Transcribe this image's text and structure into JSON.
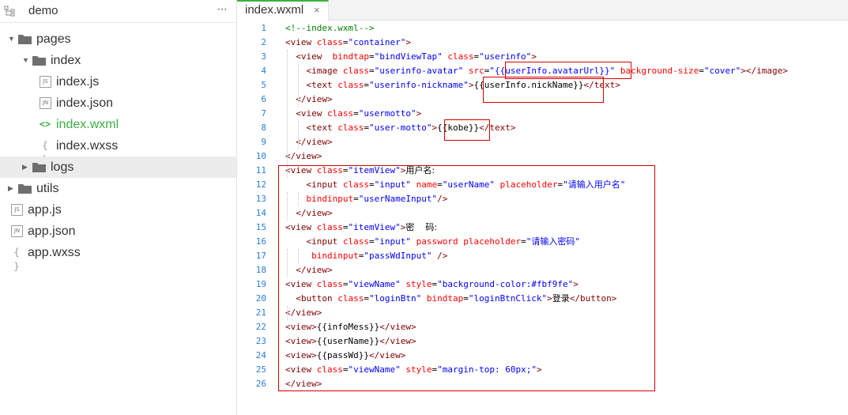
{
  "project": {
    "name": "demo",
    "more_label": "···"
  },
  "tree": [
    {
      "label": "pages",
      "kind": "folder",
      "expanded": true,
      "depth": 0
    },
    {
      "label": "index",
      "kind": "folder",
      "expanded": true,
      "depth": 1
    },
    {
      "label": "index.js",
      "kind": "file",
      "icon_text": "JS",
      "depth": 2
    },
    {
      "label": "index.json",
      "kind": "file",
      "icon_text": "JN",
      "depth": 2
    },
    {
      "label": "index.wxml",
      "kind": "glyph",
      "icon_text": "<>",
      "depth": 2,
      "active": true
    },
    {
      "label": "index.wxss",
      "kind": "glyph",
      "icon_text": "{ }",
      "depth": 2
    },
    {
      "label": "logs",
      "kind": "folder",
      "expanded": false,
      "depth": 1,
      "selected": true
    },
    {
      "label": "utils",
      "kind": "folder",
      "expanded": false,
      "depth": 0
    },
    {
      "label": "app.js",
      "kind": "file",
      "icon_text": "JS",
      "depth": 0
    },
    {
      "label": "app.json",
      "kind": "file",
      "icon_text": "JN",
      "depth": 0
    },
    {
      "label": "app.wxss",
      "kind": "glyph",
      "icon_text": "{ }",
      "depth": 0
    }
  ],
  "editor": {
    "tab": {
      "label": "index.wxml",
      "close": "×"
    },
    "lines": [
      {
        "n": "1",
        "tokens": [
          [
            "cm",
            "<!--index.wxml-->"
          ]
        ]
      },
      {
        "n": "2",
        "tokens": [
          [
            "tag",
            "<view"
          ],
          [
            "txt",
            " "
          ],
          [
            "attr",
            "class"
          ],
          [
            "txt",
            "="
          ],
          [
            "str",
            "\"container\""
          ],
          [
            "tag",
            ">"
          ]
        ]
      },
      {
        "n": "3",
        "tokens": [
          [
            "txt",
            "  "
          ],
          [
            "tag",
            "<view"
          ],
          [
            "txt",
            "  "
          ],
          [
            "attr",
            "bindtap"
          ],
          [
            "txt",
            "="
          ],
          [
            "str",
            "\"bindViewTap\""
          ],
          [
            "txt",
            " "
          ],
          [
            "attr",
            "class"
          ],
          [
            "txt",
            "="
          ],
          [
            "str",
            "\"userinfo\""
          ],
          [
            "tag",
            ">"
          ]
        ]
      },
      {
        "n": "4",
        "tokens": [
          [
            "txt",
            "    "
          ],
          [
            "tag",
            "<image"
          ],
          [
            "txt",
            " "
          ],
          [
            "attr",
            "class"
          ],
          [
            "txt",
            "="
          ],
          [
            "str",
            "\"userinfo-avatar\""
          ],
          [
            "txt",
            " "
          ],
          [
            "attr",
            "src"
          ],
          [
            "txt",
            "="
          ],
          [
            "str",
            "\"{{userInfo.avatarUrl}}\""
          ],
          [
            "txt",
            " "
          ],
          [
            "attr",
            "background-size"
          ],
          [
            "txt",
            "="
          ],
          [
            "str",
            "\"cover\""
          ],
          [
            "tag",
            "></image>"
          ]
        ]
      },
      {
        "n": "5",
        "tokens": [
          [
            "txt",
            "    "
          ],
          [
            "tag",
            "<text"
          ],
          [
            "txt",
            " "
          ],
          [
            "attr",
            "class"
          ],
          [
            "txt",
            "="
          ],
          [
            "str",
            "\"userinfo-nickname\""
          ],
          [
            "tag",
            ">"
          ],
          [
            "txt",
            "{{userInfo.nickName}}"
          ],
          [
            "tag",
            "</text>"
          ]
        ]
      },
      {
        "n": "6",
        "tokens": [
          [
            "txt",
            "  "
          ],
          [
            "tag",
            "</view>"
          ]
        ]
      },
      {
        "n": "7",
        "tokens": [
          [
            "txt",
            "  "
          ],
          [
            "tag",
            "<view"
          ],
          [
            "txt",
            " "
          ],
          [
            "attr",
            "class"
          ],
          [
            "txt",
            "="
          ],
          [
            "str",
            "\"usermotto\""
          ],
          [
            "tag",
            ">"
          ]
        ]
      },
      {
        "n": "8",
        "tokens": [
          [
            "txt",
            "    "
          ],
          [
            "tag",
            "<text"
          ],
          [
            "txt",
            " "
          ],
          [
            "attr",
            "class"
          ],
          [
            "txt",
            "="
          ],
          [
            "str",
            "\"user-motto\""
          ],
          [
            "tag",
            ">"
          ],
          [
            "txt",
            "{{kobe}}"
          ],
          [
            "tag",
            "</text>"
          ]
        ]
      },
      {
        "n": "9",
        "tokens": [
          [
            "txt",
            "  "
          ],
          [
            "tag",
            "</view>"
          ]
        ]
      },
      {
        "n": "10",
        "tokens": [
          [
            "tag",
            "</view>"
          ]
        ]
      },
      {
        "n": "11",
        "tokens": [
          [
            "tag",
            "<view"
          ],
          [
            "txt",
            " "
          ],
          [
            "attr",
            "class"
          ],
          [
            "txt",
            "="
          ],
          [
            "str",
            "\"itemView\""
          ],
          [
            "tag",
            ">"
          ],
          [
            "cjk",
            "用户名:"
          ]
        ]
      },
      {
        "n": "12",
        "tokens": [
          [
            "txt",
            "    "
          ],
          [
            "tag",
            "<input"
          ],
          [
            "txt",
            " "
          ],
          [
            "attr",
            "class"
          ],
          [
            "txt",
            "="
          ],
          [
            "str",
            "\"input\""
          ],
          [
            "txt",
            " "
          ],
          [
            "attr",
            "name"
          ],
          [
            "txt",
            "="
          ],
          [
            "str",
            "\"userName\""
          ],
          [
            "txt",
            " "
          ],
          [
            "attr",
            "placeholder"
          ],
          [
            "txt",
            "="
          ],
          [
            "str",
            "\""
          ],
          [
            "cjkstr",
            "请输入用户名"
          ],
          [
            "str",
            "\""
          ]
        ]
      },
      {
        "n": "13",
        "tokens": [
          [
            "txt",
            "    "
          ],
          [
            "attr",
            "bindinput"
          ],
          [
            "txt",
            "="
          ],
          [
            "str",
            "\"userNameInput\""
          ],
          [
            "tag",
            "/>"
          ]
        ]
      },
      {
        "n": "14",
        "tokens": [
          [
            "txt",
            "  "
          ],
          [
            "tag",
            "</view>"
          ]
        ]
      },
      {
        "n": "15",
        "tokens": [
          [
            "tag",
            "<view"
          ],
          [
            "txt",
            " "
          ],
          [
            "attr",
            "class"
          ],
          [
            "txt",
            "="
          ],
          [
            "str",
            "\"itemView\""
          ],
          [
            "tag",
            ">"
          ],
          [
            "cjk",
            "密    码:"
          ]
        ]
      },
      {
        "n": "16",
        "tokens": [
          [
            "txt",
            "    "
          ],
          [
            "tag",
            "<input"
          ],
          [
            "txt",
            " "
          ],
          [
            "attr",
            "class"
          ],
          [
            "txt",
            "="
          ],
          [
            "str",
            "\"input\""
          ],
          [
            "txt",
            " "
          ],
          [
            "attr",
            "password"
          ],
          [
            "txt",
            " "
          ],
          [
            "attr",
            "placeholder"
          ],
          [
            "txt",
            "="
          ],
          [
            "str",
            "\""
          ],
          [
            "cjkstr",
            "请输入密码"
          ],
          [
            "str",
            "\""
          ]
        ]
      },
      {
        "n": "17",
        "tokens": [
          [
            "txt",
            "     "
          ],
          [
            "attr",
            "bindinput"
          ],
          [
            "txt",
            "="
          ],
          [
            "str",
            "\"passWdInput\""
          ],
          [
            "txt",
            " "
          ],
          [
            "tag",
            "/>"
          ]
        ]
      },
      {
        "n": "18",
        "tokens": [
          [
            "txt",
            "  "
          ],
          [
            "tag",
            "</view>"
          ]
        ]
      },
      {
        "n": "19",
        "tokens": [
          [
            "tag",
            "<view"
          ],
          [
            "txt",
            " "
          ],
          [
            "attr",
            "class"
          ],
          [
            "txt",
            "="
          ],
          [
            "str",
            "\"viewName\""
          ],
          [
            "txt",
            " "
          ],
          [
            "attr",
            "style"
          ],
          [
            "txt",
            "="
          ],
          [
            "str",
            "\"background-color:#fbf9fe\""
          ],
          [
            "tag",
            ">"
          ]
        ]
      },
      {
        "n": "20",
        "tokens": [
          [
            "txt",
            "  "
          ],
          [
            "tag",
            "<button"
          ],
          [
            "txt",
            " "
          ],
          [
            "attr",
            "class"
          ],
          [
            "txt",
            "="
          ],
          [
            "str",
            "\"loginBtn\""
          ],
          [
            "txt",
            " "
          ],
          [
            "attr",
            "bindtap"
          ],
          [
            "txt",
            "="
          ],
          [
            "str",
            "\"loginBtnClick\""
          ],
          [
            "tag",
            ">"
          ],
          [
            "cjk",
            "登录"
          ],
          [
            "tag",
            "</button>"
          ]
        ]
      },
      {
        "n": "21",
        "tokens": [
          [
            "tag",
            "</view>"
          ]
        ]
      },
      {
        "n": "22",
        "tokens": [
          [
            "tag",
            "<view>"
          ],
          [
            "txt",
            "{{infoMess}}"
          ],
          [
            "tag",
            "</view>"
          ]
        ]
      },
      {
        "n": "23",
        "tokens": [
          [
            "tag",
            "<view>"
          ],
          [
            "txt",
            "{{userName}}"
          ],
          [
            "tag",
            "</view>"
          ]
        ]
      },
      {
        "n": "24",
        "tokens": [
          [
            "tag",
            "<view>"
          ],
          [
            "txt",
            "{{passWd}}"
          ],
          [
            "tag",
            "</view>"
          ]
        ]
      },
      {
        "n": "25",
        "tokens": [
          [
            "tag",
            "<view"
          ],
          [
            "txt",
            " "
          ],
          [
            "attr",
            "class"
          ],
          [
            "txt",
            "="
          ],
          [
            "str",
            "\"viewName\""
          ],
          [
            "txt",
            " "
          ],
          [
            "attr",
            "style"
          ],
          [
            "txt",
            "="
          ],
          [
            "str",
            "\"margin-top: 60px;\""
          ],
          [
            "tag",
            ">"
          ]
        ]
      },
      {
        "n": "26",
        "tokens": [
          [
            "tag",
            "</view>"
          ]
        ]
      }
    ]
  },
  "colors": {
    "accent": "#3cb043",
    "line_number": "#2a7fd4",
    "tag": "#800000",
    "attribute": "#ff0000",
    "string": "#0000ff",
    "comment": "#008000",
    "annotation_box": "#d60000"
  }
}
